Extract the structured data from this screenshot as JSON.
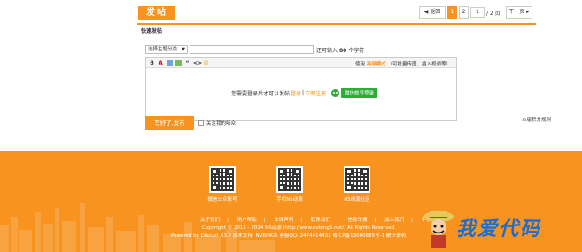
{
  "header": {
    "post_button": "发帖",
    "pager": {
      "back": "◀ 返回",
      "pages": [
        "1",
        "2"
      ],
      "current_page": "1",
      "page_input": "1",
      "total": "/ 2 页",
      "next": "下一页 ▸"
    }
  },
  "quick_post": {
    "tab_title": "快速发帖",
    "type_select": "选择主题分类",
    "title_value": "",
    "char_hint_prefix": "还可输入",
    "char_count": "80",
    "char_hint_suffix": "个字符",
    "toolbar": {
      "tools": [
        "B",
        "A",
        "img",
        "link",
        "quote",
        "code",
        "emoji"
      ],
      "advanced_prefix": "使用",
      "advanced_link": "高级模式",
      "advanced_suffix": "（可批量传图、插入视频等）"
    },
    "login_hint": {
      "prefix": "您需要登录后才可以发帖",
      "login": "登录",
      "sep": "|",
      "register": "立即注册",
      "wechat_button": "微信帐号登录"
    },
    "submit_button": "写好了,发布",
    "follow_label": "关注我的听众",
    "rules_link": "本版积分规则"
  },
  "footer": {
    "qr_codes": [
      {
        "label": "微信公众账号"
      },
      {
        "label": "手机NS动源"
      },
      {
        "label": "NS动源社区"
      }
    ],
    "links": [
      "关于我们",
      "用户帮助",
      "法律声明",
      "联系我们",
      "信息举报",
      "加入我们",
      "手机社区"
    ],
    "link_sep": "|",
    "copyright": "Copyright © 2011 - 2014  NS动源  (http://www.nvbing5.net/) All Rights Reserved",
    "powered": "Powered by  Discuz!  X3.2  技术支持: NVBING5    客服QQ: 2474414431    粤ICP备13000885号-1  统计说明",
    "watermark_text": "我爱代码"
  },
  "colors": {
    "accent": "#f7931e",
    "wechat": "#2dad38",
    "watermark": "#1f6bd1"
  }
}
